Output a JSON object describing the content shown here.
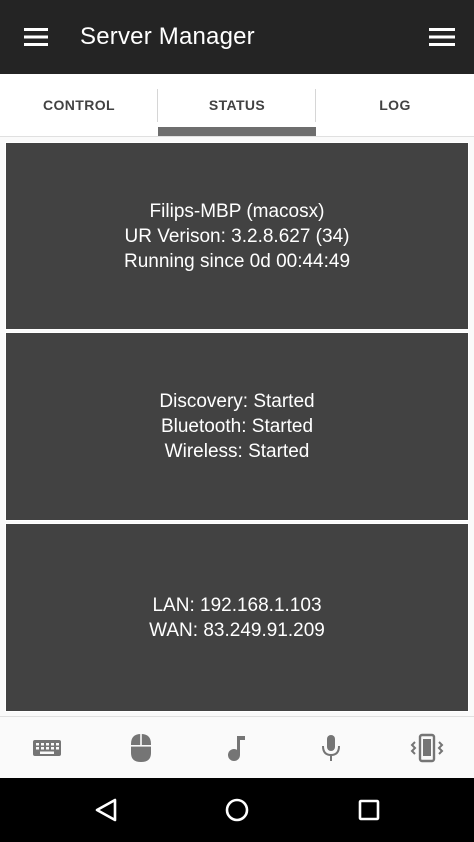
{
  "app": {
    "title": "Server Manager"
  },
  "appbar": {
    "left_icon": "menu-icon",
    "right_icon": "menu-icon"
  },
  "tabs": [
    {
      "label": "CONTROL",
      "selected": false
    },
    {
      "label": "STATUS",
      "selected": true
    },
    {
      "label": "LOG",
      "selected": false
    }
  ],
  "cards": [
    {
      "lines": [
        "Filips-MBP (macosx)",
        "UR Verison: 3.2.8.627 (34)",
        "Running since 0d 00:44:49"
      ]
    },
    {
      "lines": [
        "Discovery: Started",
        "Bluetooth: Started",
        "Wireless: Started"
      ]
    },
    {
      "lines": [
        "LAN: 192.168.1.103",
        "WAN: 83.249.91.209"
      ]
    }
  ],
  "bottom_bar": {
    "items": [
      {
        "icon": "keyboard-icon"
      },
      {
        "icon": "mouse-icon"
      },
      {
        "icon": "music-note-icon"
      },
      {
        "icon": "microphone-icon"
      },
      {
        "icon": "phone-vibrate-icon"
      }
    ]
  },
  "system_nav": {
    "items": [
      "back-icon",
      "home-icon",
      "recent-apps-icon"
    ]
  },
  "colors": {
    "app_bar": "#242424",
    "card_background": "#424242",
    "tab_indicator": "#6e6e6e",
    "system_nav": "#000000",
    "icon_gray": "#757575"
  }
}
